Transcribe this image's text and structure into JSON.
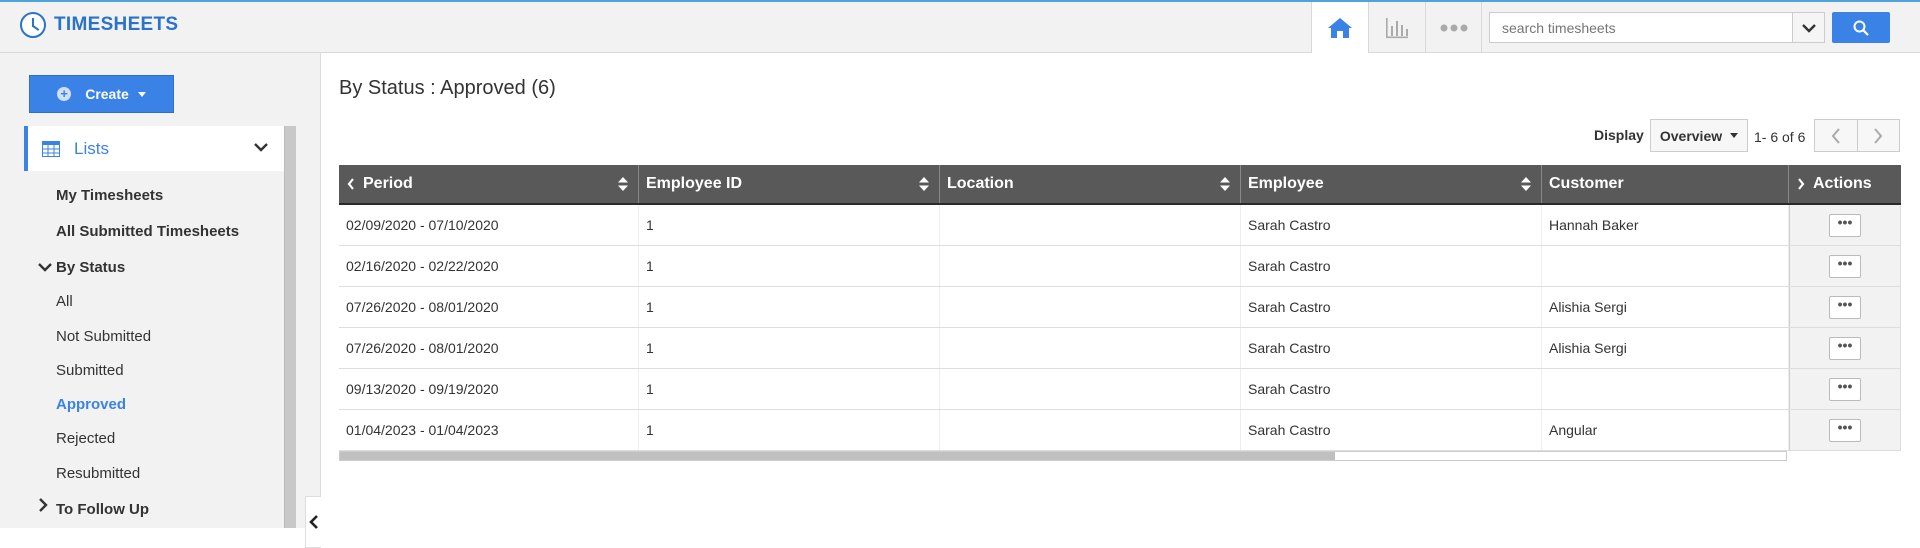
{
  "app": {
    "title": "TIMESHEETS"
  },
  "header": {
    "icons": [
      "home-icon",
      "chart-icon",
      "more-icon"
    ],
    "search": {
      "placeholder": "search timesheets",
      "value": ""
    }
  },
  "sidebar": {
    "create_label": "Create",
    "lists_label": "Lists",
    "items": {
      "my_timesheets": "My Timesheets",
      "all_submitted": "All Submitted Timesheets",
      "by_status": "By Status",
      "all": "All",
      "not_submitted": "Not Submitted",
      "submitted": "Submitted",
      "approved": "Approved",
      "rejected": "Rejected",
      "resubmitted": "Resubmitted",
      "to_follow_up": "To Follow Up"
    }
  },
  "main": {
    "title": "By Status : Approved (6)",
    "display_label": "Display",
    "display_value": "Overview",
    "pager_text": "1- 6 of 6",
    "columns": [
      "Period",
      "Employee ID",
      "Location",
      "Employee",
      "Customer",
      "Actions"
    ],
    "rows": [
      {
        "period": "02/09/2020 - 07/10/2020",
        "employee_id": "1",
        "location": "",
        "employee": "Sarah Castro",
        "customer": "Hannah Baker",
        "action": "•••"
      },
      {
        "period": "02/16/2020 - 02/22/2020",
        "employee_id": "1",
        "location": "",
        "employee": "Sarah Castro",
        "customer": "",
        "action": "•••"
      },
      {
        "period": "07/26/2020 - 08/01/2020",
        "employee_id": "1",
        "location": "",
        "employee": "Sarah Castro",
        "customer": "Alishia Sergi",
        "action": "•••"
      },
      {
        "period": "07/26/2020 - 08/01/2020",
        "employee_id": "1",
        "location": "",
        "employee": "Sarah Castro",
        "customer": "Alishia Sergi",
        "action": "•••"
      },
      {
        "period": "09/13/2020 - 09/19/2020",
        "employee_id": "1",
        "location": "",
        "employee": "Sarah Castro",
        "customer": "",
        "action": "•••"
      },
      {
        "period": "01/04/2023 - 01/04/2023",
        "employee_id": "1",
        "location": "",
        "employee": "Sarah Castro",
        "customer": "Angular",
        "action": "•••"
      }
    ]
  },
  "colors": {
    "accent": "#3b82e6",
    "header_bg": "#595959",
    "sidebar_bg": "#f2f2f2"
  }
}
